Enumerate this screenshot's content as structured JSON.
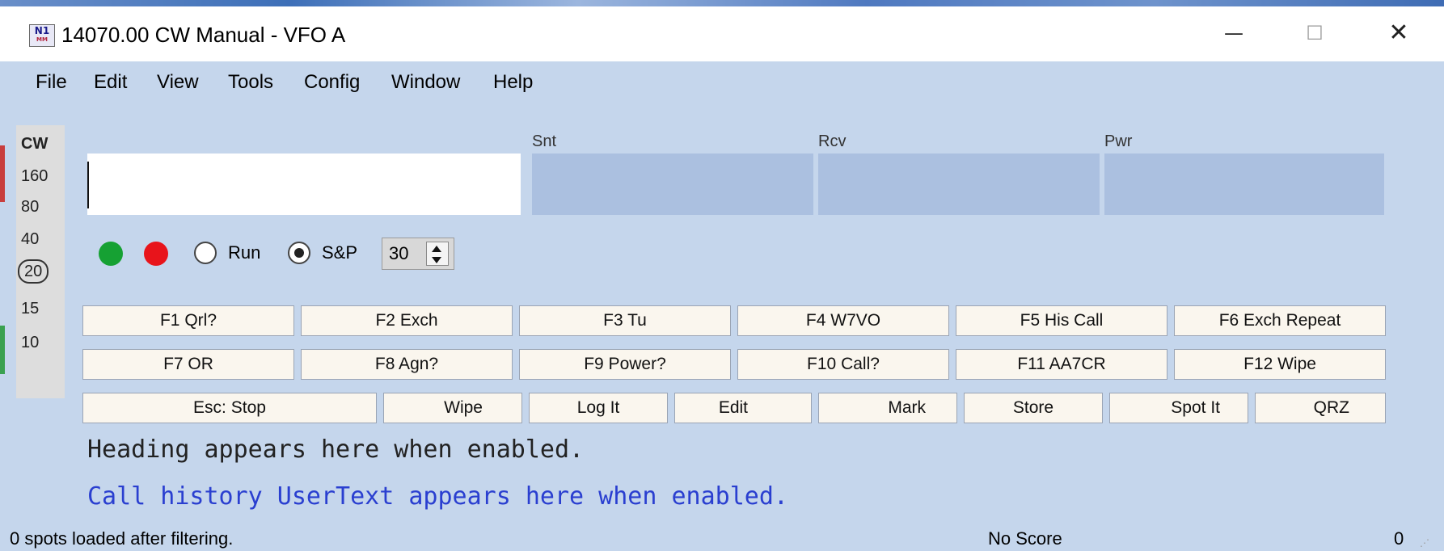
{
  "window": {
    "title": "14070.00 CW Manual - VFO A",
    "icon_label": "N1",
    "icon_sub": "MM",
    "minimize_glyph": "—",
    "maximize_glyph": "☐",
    "close_glyph": "✕"
  },
  "menu": [
    "File",
    "Edit",
    "View",
    "Tools",
    "Config",
    "Window",
    "Help"
  ],
  "bands": {
    "mode": "CW",
    "items": [
      "160",
      "80",
      "40",
      "20",
      "15",
      "10"
    ],
    "selected": "20"
  },
  "fields": {
    "call_value": "",
    "snt_label": "Snt",
    "rcv_label": "Rcv",
    "pwr_label": "Pwr"
  },
  "controls": {
    "run_label": "Run",
    "sp_label": "S&P",
    "selected_mode": "S&P",
    "speed_value": "30",
    "green_status": "#16a133",
    "red_status": "#e8141b"
  },
  "function_keys_row1": [
    "F1 Qrl?",
    "F2 Exch",
    "F3 Tu",
    "F4 W7VO",
    "F5 His Call",
    "F6 Exch Repeat"
  ],
  "function_keys_row2": [
    "F7 OR",
    "F8 Agn?",
    "F9 Power?",
    "F10 Call?",
    "F11 AA7CR",
    "F12 Wipe"
  ],
  "action_buttons": [
    "Esc: Stop",
    "Wipe",
    "Log It",
    "Edit",
    "Mark",
    "Store",
    "Spot It",
    "QRZ"
  ],
  "info": {
    "heading": "Heading appears here when enabled.",
    "usertext": "Call history UserText appears here when enabled."
  },
  "status": {
    "spots": "0 spots loaded after filtering.",
    "score": "No Score",
    "count": "0"
  }
}
